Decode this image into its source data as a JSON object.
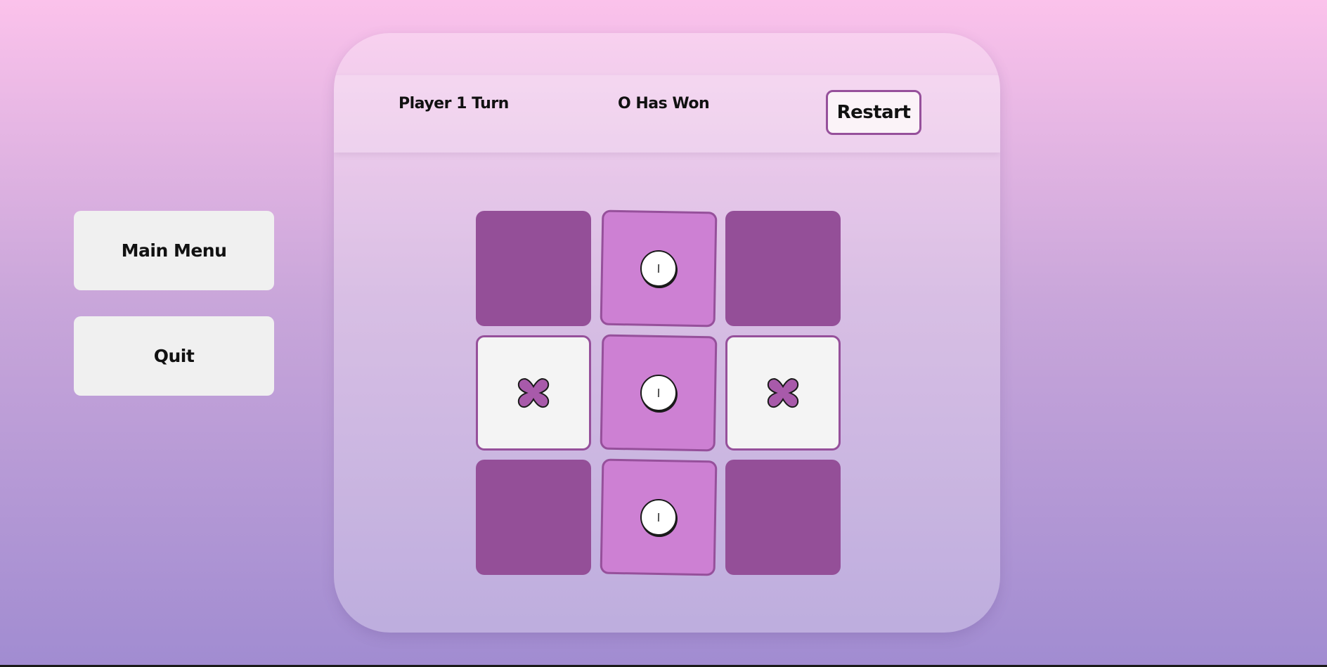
{
  "sidebar": {
    "main_menu_label": "Main Menu",
    "quit_label": "Quit"
  },
  "header": {
    "turn_text": "Player 1 Turn",
    "status_text": "O Has Won",
    "restart_label": "Restart"
  },
  "board": {
    "cells": [
      "",
      "O",
      "",
      "X",
      "O",
      "X",
      "",
      "O",
      ""
    ],
    "winning_line": [
      1,
      4,
      7
    ]
  },
  "colors": {
    "empty_cell": "#944f98",
    "o_cell": "#cd80d3",
    "x_cell": "#f4f4f4",
    "cell_border": "#96509b",
    "x_mark": "#a85aaa"
  },
  "icons": {
    "x_mark": "x-mark-icon",
    "o_mark": "o-mark-icon"
  }
}
